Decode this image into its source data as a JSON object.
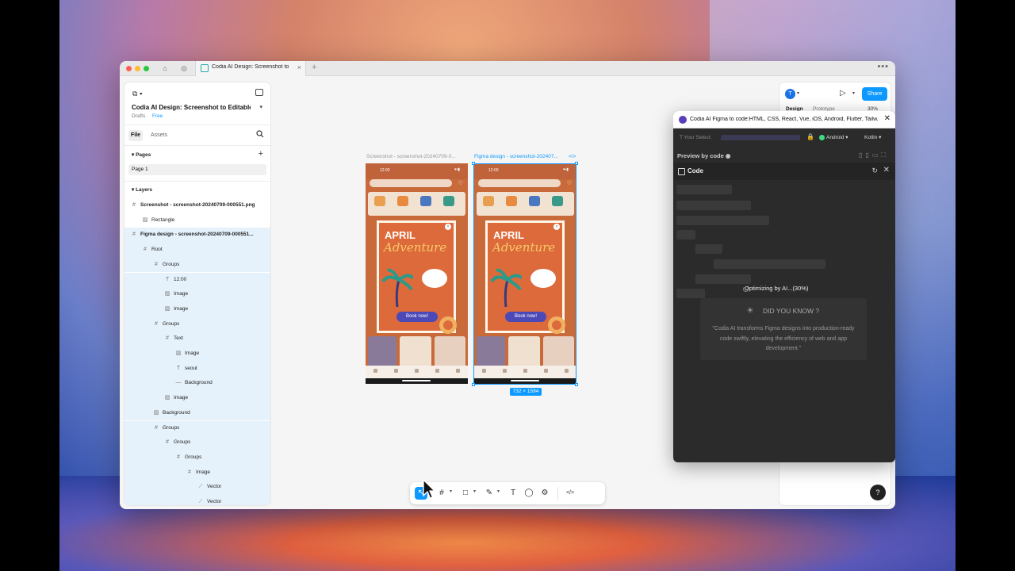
{
  "browser": {
    "tab_title": "Codia AI Design: Screenshot to E",
    "more_label": "•••",
    "new_tab_label": "+"
  },
  "left_panel": {
    "file_title": "Codia AI Design: Screenshot to Editable ...",
    "drafts_label": "Drafts",
    "plan_label": "Free",
    "tabs": {
      "file": "File",
      "assets": "Assets"
    },
    "pages_heading": "Pages",
    "pages": [
      "Page 1"
    ],
    "layers_heading": "Layers",
    "layers": [
      {
        "name": "Screenshot - screenshot-20240709-000551.png",
        "icon": "frame-icon",
        "glyph": "#",
        "depth": 0,
        "bold": true,
        "selected": false
      },
      {
        "name": "Rectangle",
        "icon": "image-icon",
        "glyph": "▨",
        "depth": 1,
        "bold": false,
        "selected": false
      },
      {
        "name": "Figma design - screenshot-20240709-000551...",
        "icon": "frame-icon",
        "glyph": "#",
        "depth": 0,
        "bold": true,
        "selected": true
      },
      {
        "name": "Root",
        "icon": "frame-icon",
        "glyph": "#",
        "depth": 1,
        "bold": false,
        "selected": true
      },
      {
        "name": "Groups",
        "icon": "frame-icon",
        "glyph": "#",
        "depth": 2,
        "bold": false,
        "selected": true
      },
      {
        "name": "12:00",
        "icon": "text-icon",
        "glyph": "T",
        "depth": 3,
        "bold": false,
        "selected": true
      },
      {
        "name": "Image",
        "icon": "image-icon",
        "glyph": "▨",
        "depth": 3,
        "bold": false,
        "selected": true
      },
      {
        "name": "Image",
        "icon": "image-icon",
        "glyph": "▨",
        "depth": 3,
        "bold": false,
        "selected": true
      },
      {
        "name": "Groups",
        "icon": "frame-icon",
        "glyph": "#",
        "depth": 2,
        "bold": false,
        "selected": true
      },
      {
        "name": "Text",
        "icon": "frame-icon",
        "glyph": "#",
        "depth": 3,
        "bold": false,
        "selected": true
      },
      {
        "name": "Image",
        "icon": "image-icon",
        "glyph": "▨",
        "depth": 4,
        "bold": false,
        "selected": true
      },
      {
        "name": "seoul",
        "icon": "text-icon",
        "glyph": "T",
        "depth": 4,
        "bold": false,
        "selected": true
      },
      {
        "name": "Background",
        "icon": "line-icon",
        "glyph": "—",
        "depth": 4,
        "bold": false,
        "selected": true
      },
      {
        "name": "Image",
        "icon": "image-icon",
        "glyph": "▨",
        "depth": 3,
        "bold": false,
        "selected": true
      },
      {
        "name": "Background",
        "icon": "image-icon",
        "glyph": "▨",
        "depth": 2,
        "bold": false,
        "selected": true
      },
      {
        "name": "Groups",
        "icon": "frame-icon",
        "glyph": "#",
        "depth": 2,
        "bold": false,
        "selected": true
      },
      {
        "name": "Groups",
        "icon": "frame-icon",
        "glyph": "#",
        "depth": 3,
        "bold": false,
        "selected": true
      },
      {
        "name": "Groups",
        "icon": "frame-icon",
        "glyph": "#",
        "depth": 4,
        "bold": false,
        "selected": true
      },
      {
        "name": "Image",
        "icon": "frame-icon",
        "glyph": "#",
        "depth": 5,
        "bold": false,
        "selected": true
      },
      {
        "name": "Vector",
        "icon": "vector-icon",
        "glyph": "⟋",
        "depth": 6,
        "bold": false,
        "selected": true
      },
      {
        "name": "Vector",
        "icon": "vector-icon",
        "glyph": "⟋",
        "depth": 6,
        "bold": false,
        "selected": true
      }
    ]
  },
  "canvas": {
    "frame1_label": "Screenshot - screenshot-20240709-0...",
    "frame2_label": "Figma design - screenshot-202407...",
    "frame2_code_icon": "</>",
    "size_badge": "732 × 1594",
    "phone": {
      "time": "12:00",
      "promo_title": "APRIL",
      "promo_subtitle": "Adventure",
      "book_button": "Book now!",
      "close_glyph": "×",
      "signal_glyphs": "▾▪▮"
    }
  },
  "toolbar": {
    "tools": [
      {
        "name": "move-tool",
        "glyph": "↖",
        "active": true
      },
      {
        "name": "frame-tool",
        "glyph": "#",
        "active": false
      },
      {
        "name": "shape-tool",
        "glyph": "□",
        "active": false
      },
      {
        "name": "pen-tool",
        "glyph": "✎",
        "active": false
      },
      {
        "name": "text-tool",
        "glyph": "T",
        "active": false
      },
      {
        "name": "comment-tool",
        "glyph": "◯",
        "active": false
      },
      {
        "name": "actions-tool",
        "glyph": "⚙",
        "active": false
      },
      {
        "name": "dev-mode-tool",
        "glyph": "</>",
        "active": false
      }
    ],
    "caret_glyph": "▾"
  },
  "right_panel": {
    "avatar_initial": "T",
    "share_label": "Share",
    "design_tab": "Design",
    "prototype_tab": "Prototype",
    "zoom": "30%",
    "help_label": "?",
    "caret_glyph": "▾",
    "play_glyph": "▷"
  },
  "plugin": {
    "title": "Codia AI Figma to code:HTML, CSS, React, Vue, iOS, Android, Flutter, Tailw...",
    "select_prefix": "T  Your Select:",
    "platform": "Android",
    "language": "Kotlin",
    "preview_label": "Preview by code",
    "code_label": "Code",
    "progress_text": "Optimizing by AI...(30%)",
    "progress_percent": 30,
    "dyk_title": "DID YOU KNOW ?",
    "dyk_text": "\"Codia AI transforms Figma designs into production-ready code swiftly, elevating the efficiency of web and app development.\"",
    "close_glyph": "✕",
    "refresh_glyph": "↻",
    "lock_glyph": "🔒",
    "device_glyphs": "▯▯▭⛶",
    "sun_glyph": "☀"
  }
}
